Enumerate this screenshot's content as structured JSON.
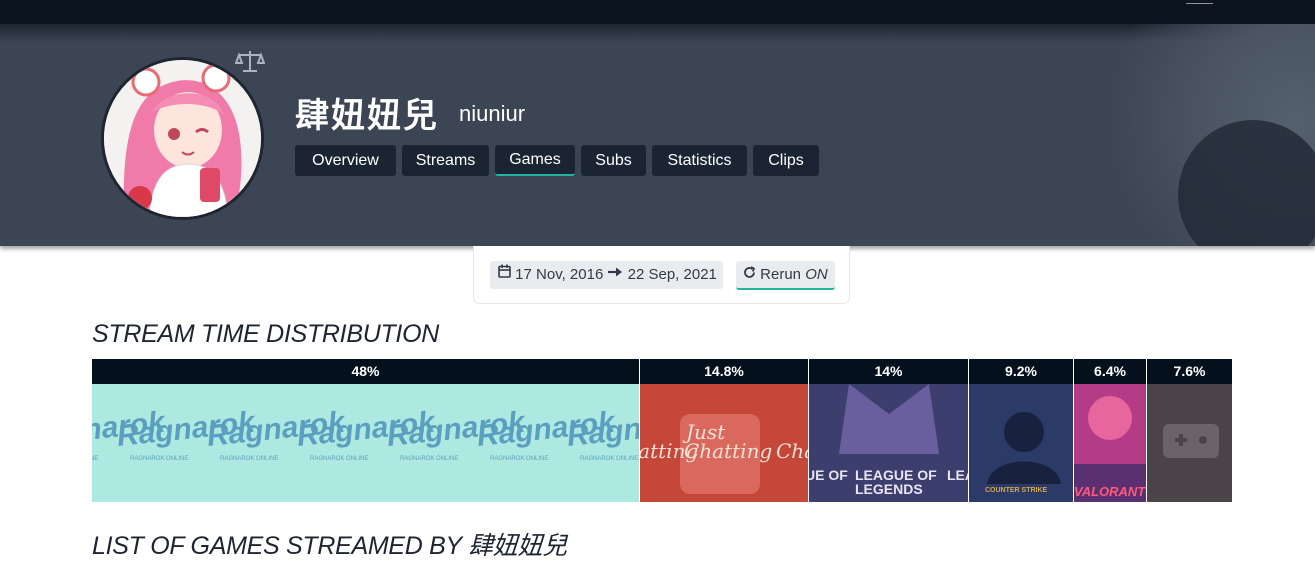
{
  "channel": {
    "display_name": "肆妞妞兒",
    "login": "niuniur"
  },
  "tabs": [
    {
      "label": "Overview",
      "active": false
    },
    {
      "label": "Streams",
      "active": false
    },
    {
      "label": "Games",
      "active": true
    },
    {
      "label": "Subs",
      "active": false
    },
    {
      "label": "Statistics",
      "active": false
    },
    {
      "label": "Clips",
      "active": false
    }
  ],
  "filter": {
    "date_from": "17 Nov, 2016",
    "date_to": "22 Sep, 2021",
    "rerun_label": "Rerun",
    "rerun_state": "ON"
  },
  "sections": {
    "distribution_title": "STREAM TIME DISTRIBUTION",
    "list_title_prefix": "LIST OF GAMES STREAMED BY",
    "list_title_name": "肆妞妞兒"
  },
  "distribution": [
    {
      "label": "48%",
      "share": 48,
      "tile": "Ragnarok",
      "tile_sub": "RAGNAROK ONLINE",
      "color": "#aee9e1"
    },
    {
      "label": "14.8%",
      "share": 14.8,
      "tile": "Just Chatting",
      "color": "#c4473a"
    },
    {
      "label": "14%",
      "share": 14,
      "tile": "LEAGUE OF LEGENDS",
      "color": "#3c3f6e"
    },
    {
      "label": "9.2%",
      "share": 9.2,
      "tile": "COUNTER STRIKE",
      "color": "#2b3a66"
    },
    {
      "label": "6.4%",
      "share": 6.4,
      "tile": "VALORANT",
      "color": "#b43c86"
    },
    {
      "label": "7.6%",
      "share": 7.6,
      "tile": "controller-icon",
      "color": "#4a4448"
    }
  ]
}
